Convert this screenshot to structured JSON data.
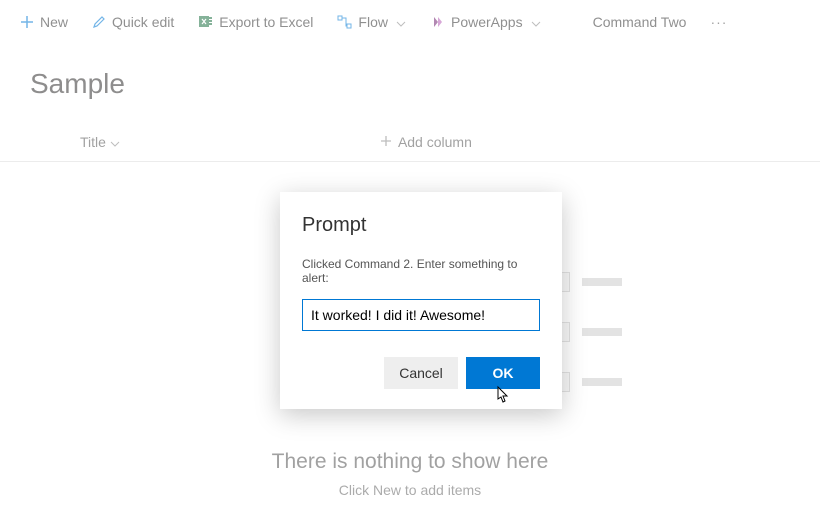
{
  "toolbar": {
    "new_label": "New",
    "quickedit_label": "Quick edit",
    "export_label": "Export to Excel",
    "flow_label": "Flow",
    "powerapps_label": "PowerApps",
    "command2_label": "Command Two"
  },
  "page": {
    "title": "Sample"
  },
  "columns": {
    "title_label": "Title",
    "add_label": "Add column"
  },
  "empty": {
    "title": "There is nothing to show here",
    "subtitle": "Click New to add items"
  },
  "dialog": {
    "title": "Prompt",
    "message": "Clicked Command 2. Enter something to alert:",
    "input_value": "It worked! I did it! Awesome!",
    "cancel_label": "Cancel",
    "ok_label": "OK"
  }
}
